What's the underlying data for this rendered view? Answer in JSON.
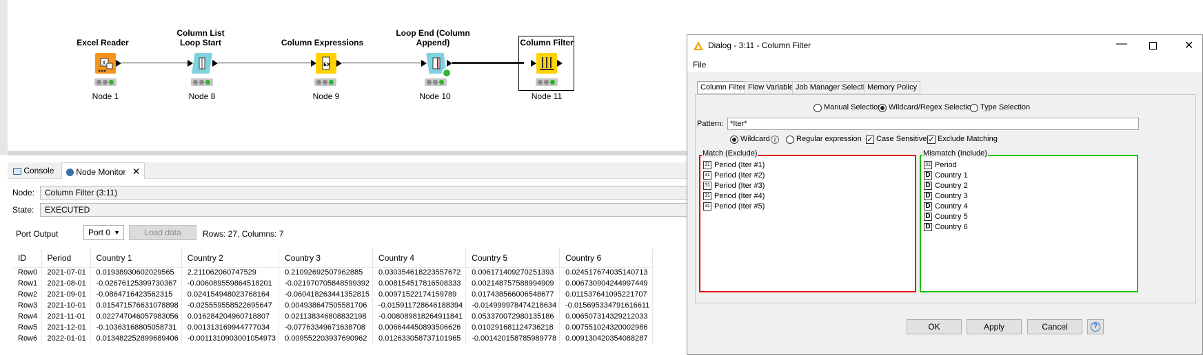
{
  "workflow": {
    "nodes": [
      {
        "title": "Excel Reader",
        "label": "Node 1",
        "icon": "excel-reader-icon",
        "color": "#f7941d"
      },
      {
        "title": "Column List Loop Start",
        "label": "Node 8",
        "icon": "loop-start-icon",
        "color": "#7fd3e0"
      },
      {
        "title": "Column Expressions",
        "label": "Node 9",
        "icon": "column-expressions-icon",
        "color": "#ffd200"
      },
      {
        "title": "Loop End (Column Append)",
        "label": "Node 10",
        "icon": "loop-end-icon",
        "color": "#7fd3e0"
      },
      {
        "title": "Column Filter",
        "label": "Node 11",
        "icon": "column-filter-icon",
        "color": "#ffd200"
      }
    ]
  },
  "bottom_panel": {
    "tabs": [
      {
        "label": "Console",
        "icon": "console-icon"
      },
      {
        "label": "Node Monitor",
        "icon": "node-monitor-icon"
      }
    ],
    "node_label": "Node:",
    "node_value": "Column Filter  (3:11)",
    "state_label": "State:",
    "state_value": "EXECUTED",
    "port_output_label": "Port Output",
    "port_value": "Port 0",
    "load_data_label": "Load data",
    "summary": "Rows: 27, Columns: 7",
    "table": {
      "headers": [
        "ID",
        "Period",
        "Country 1",
        "Country 2",
        "Country 3",
        "Country 4",
        "Country 5",
        "Country 6"
      ],
      "rows": [
        [
          "Row0",
          "2021-07-01",
          "0.01938930602029565",
          "2.211062060747529",
          "0.21092692507962885",
          "0.030354618223557672",
          "0.006171409270251393",
          "0.024517674035140713"
        ],
        [
          "Row1",
          "2021-08-01",
          "-0.02676125399730367",
          "-0.006089559864518201",
          "-0.021970705848599392",
          "0.008154517816508333",
          "0.002148757588994909",
          "0.006730904244997449"
        ],
        [
          "Row2",
          "2021-09-01",
          "-0.0864716423562315",
          "0.024154948023768164",
          "-0.060418263441352815",
          "0.00971522174159789",
          "0.017438566006548677",
          "0.011537641095221707"
        ],
        [
          "Row3",
          "2021-10-01",
          "0.015471576631078898",
          "-0.025559558522695647",
          "0.004938647505581706",
          "-0.015911728646188394",
          "-0.014999978474218634",
          "-0.015695334791616611"
        ],
        [
          "Row4",
          "2021-11-01",
          "0.022747046057983056",
          "0.016284204960718807",
          "0.021138346808832198",
          "-0.008089818264911841",
          "0.053370072980135186",
          "0.006507314329212033"
        ],
        [
          "Row5",
          "2021-12-01",
          "-0.10363168805058731",
          "0.001313169944777034",
          "-0.07763349671638708",
          "0.006644450893506626",
          "0.010291681124736218",
          "0.007551024320002986"
        ],
        [
          "Row6",
          "2022-01-01",
          "0.013482252899689406",
          "-0.0011310903001054973",
          "0.009552203937690962",
          "0.012633058737101965",
          "-0.001420158785989778",
          "0.009130420354088287"
        ]
      ]
    }
  },
  "dialog": {
    "title": "Dialog - 3:11 - Column Filter",
    "menu": "File",
    "tabs": [
      "Column Filter",
      "Flow Variables",
      "Job Manager Selection",
      "Memory Policy"
    ],
    "modes": [
      "Manual Selection",
      "Wildcard/Regex Selection",
      "Type Selection"
    ],
    "pattern_label": "Pattern:",
    "pattern_value": "*Iter*",
    "wildcard_label": "Wildcard",
    "regex_label": "Regular expression",
    "case_sensitive_label": "Case Sensitive",
    "exclude_matching_label": "Exclude Matching",
    "match_title": "Match (Exclude)",
    "match_items": [
      "Period (Iter #1)",
      "Period (Iter #2)",
      "Period (Iter #3)",
      "Period (Iter #4)",
      "Period (Iter #5)"
    ],
    "mismatch_title": "Mismatch (Include)",
    "mismatch_items": [
      {
        "type": "31",
        "name": "Period"
      },
      {
        "type": "D",
        "name": "Country 1"
      },
      {
        "type": "D",
        "name": "Country 2"
      },
      {
        "type": "D",
        "name": "Country 3"
      },
      {
        "type": "D",
        "name": "Country 4"
      },
      {
        "type": "D",
        "name": "Country 5"
      },
      {
        "type": "D",
        "name": "Country 6"
      }
    ],
    "ok_label": "OK",
    "apply_label": "Apply",
    "cancel_label": "Cancel",
    "colors": {
      "exclude_border": "#e00000",
      "include_border": "#00c000"
    }
  }
}
